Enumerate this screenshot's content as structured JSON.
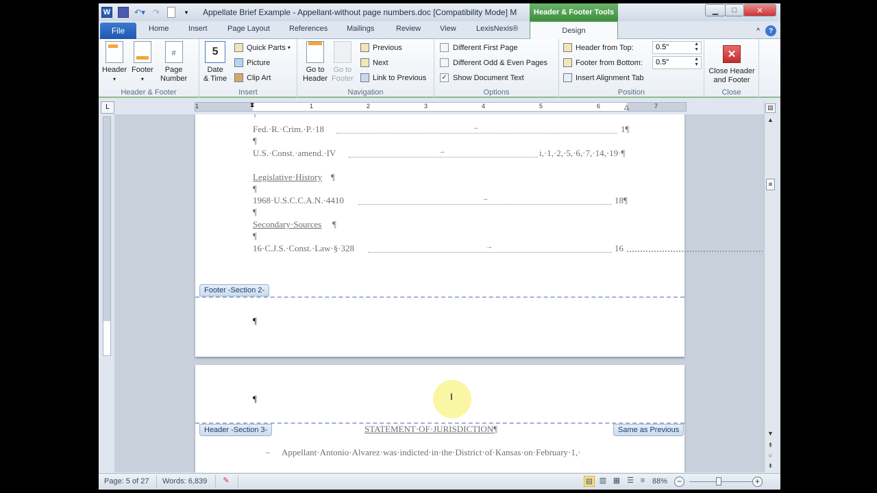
{
  "window": {
    "title": "Appellate Brief Example - Appellant-without page numbers.doc [Compatibility Mode] M",
    "context_tab": "Header & Footer Tools",
    "app_icon": "W",
    "qat": [
      "save-icon",
      "undo-icon",
      "redo-icon",
      "new-doc-icon",
      "customize-qat-icon"
    ],
    "controls": {
      "minimize": "▁",
      "maximize": "□",
      "close": "✕"
    }
  },
  "tabs": {
    "file": "File",
    "items": [
      "Home",
      "Insert",
      "Page Layout",
      "References",
      "Mailings",
      "Review",
      "View",
      "LexisNexis®"
    ],
    "active": "Design",
    "help": "?",
    "collapse": "^"
  },
  "ribbon": {
    "header_footer": {
      "label": "Header & Footer",
      "header": "Header",
      "footer": "Footer",
      "page_number_1": "Page",
      "page_number_2": "Number"
    },
    "insert": {
      "label": "Insert",
      "date_time_1": "Date",
      "date_time_2": "& Time",
      "quick_parts": "Quick Parts",
      "picture": "Picture",
      "clip_art": "Clip Art"
    },
    "navigation": {
      "label": "Navigation",
      "go_header_1": "Go to",
      "go_header_2": "Header",
      "go_footer_1": "Go to",
      "go_footer_2": "Footer",
      "previous": "Previous",
      "next": "Next",
      "link_previous": "Link to Previous"
    },
    "options": {
      "label": "Options",
      "items": [
        {
          "label": "Different First Page",
          "checked": false
        },
        {
          "label": "Different Odd & Even Pages",
          "checked": false
        },
        {
          "label": "Show Document Text",
          "checked": true
        }
      ]
    },
    "position": {
      "label": "Position",
      "header_from_top_label": "Header from Top:",
      "header_from_top_value": "0.5\"",
      "footer_from_bottom_label": "Footer from Bottom:",
      "footer_from_bottom_value": "0.5\"",
      "insert_alignment_tab": "Insert Alignment Tab"
    },
    "close": {
      "label": "Close",
      "btn_1": "Close Header",
      "btn_2": "and Footer"
    }
  },
  "ruler": {
    "corner": "L",
    "numbers": [
      "1",
      "1",
      "2",
      "3",
      "4",
      "5",
      "6",
      "7"
    ]
  },
  "document": {
    "page1": {
      "pilcrow": "¶",
      "lines": [
        {
          "text": "Fed.·R.·Crim.·P.·18",
          "page": "1¶"
        },
        {
          "text": "U.S.·Const.·amend.·IV",
          "page": "i,·1,·2,·5,·6,·7,·14,·19·¶"
        },
        {
          "heading": "Legislative·History",
          "mark": "¶"
        },
        {
          "text": "1968·U.S.C.C.A.N.·4410",
          "page": "18¶"
        },
        {
          "heading": "Secondary·Sources",
          "mark": "¶"
        },
        {
          "text": "16·C.J.S.·Const.·Law·§·328",
          "page": "16"
        }
      ],
      "footer_tag": "Footer -Section 2-",
      "footer_mark": "¶"
    },
    "page2": {
      "header_mark": "¶",
      "header_tag": "Header -Section 3-",
      "same_as_previous": "Same as Previous",
      "heading": "STATEMENT·OF·JURISDICTION¶",
      "body_arrow": "→",
      "body": "Appellant·Antonio·Alvarez·was·indicted·in·the·District·of·Kansas·on·February·1,·"
    }
  },
  "statusbar": {
    "page": "Page: 5 of 27",
    "words": "Words: 6,839",
    "zoom": "88%",
    "zoom_percent": 88,
    "views": [
      "print-layout-icon",
      "full-screen-reading-icon",
      "web-layout-icon",
      "outline-icon",
      "draft-icon"
    ]
  }
}
